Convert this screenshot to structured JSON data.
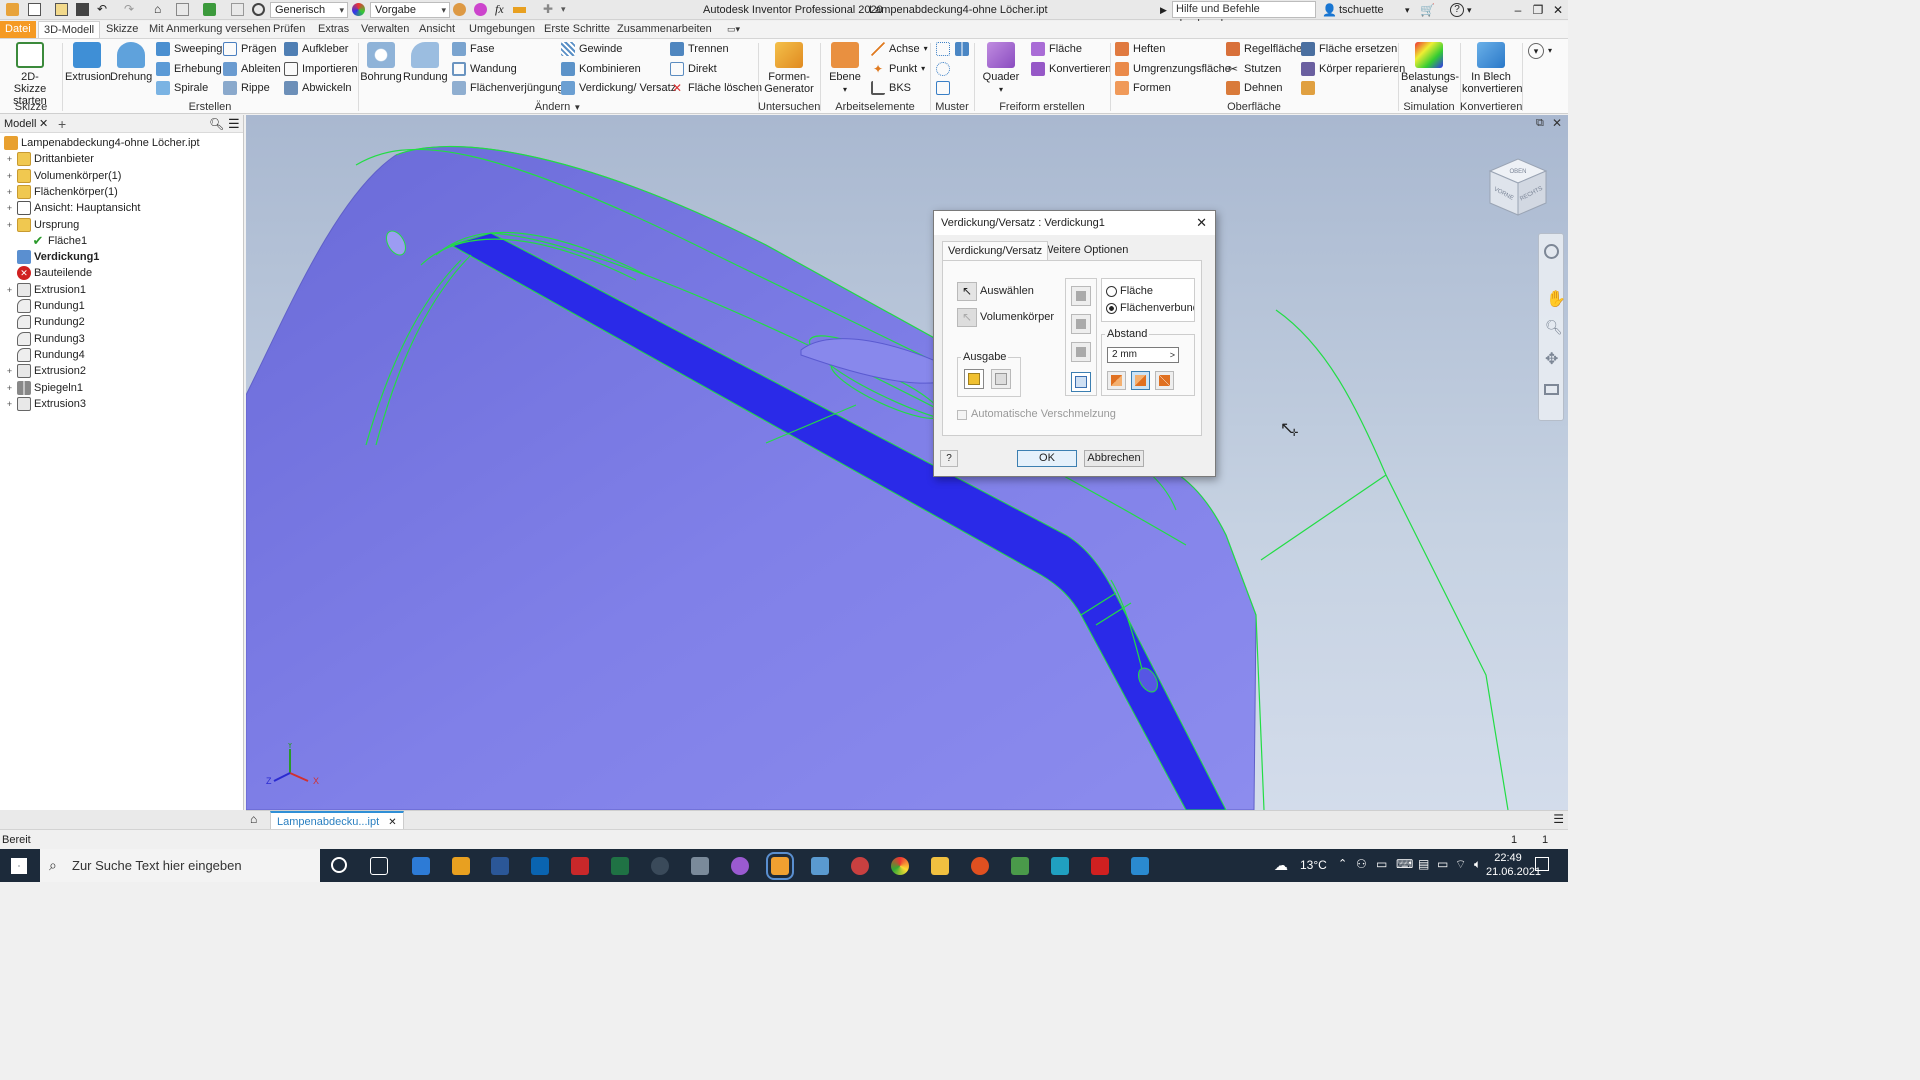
{
  "titlebar": {
    "appearance": "Generisch",
    "material": "Vorgabe",
    "title": "Autodesk Inventor Professional 2020",
    "document": "Lampenabdeckung4-ohne Löcher.ipt",
    "search": "Hilfe und Befehle durchsuchen...",
    "user": "tschuette",
    "help": "?"
  },
  "ribbon_tabs": [
    "Datei",
    "3D-Modell",
    "Skizze",
    "Mit Anmerkung versehen",
    "Prüfen",
    "Extras",
    "Verwalten",
    "Ansicht",
    "Umgebungen",
    "Erste Schritte",
    "Zusammenarbeiten"
  ],
  "ribbon": {
    "skizze_btn": "2D-Skizze starten",
    "extrusion": "Extrusion",
    "drehung": "Drehung",
    "erstellen_small": [
      "Sweeping",
      "Erhebung",
      "Spirale",
      "Prägen",
      "Ableiten",
      "Rippe",
      "Aufkleber",
      "Importieren",
      "Abwickeln"
    ],
    "bohrung": "Bohrung",
    "rundung": "Rundung",
    "aendern_small": [
      "Fase",
      "Wandung",
      "Flächenverjüngung",
      "Gewinde",
      "Kombinieren",
      "Verdickung/ Versatz",
      "Trennen",
      "Direkt",
      "Fläche löschen"
    ],
    "formen_gen": "Formen-Generator",
    "ebene": "Ebene",
    "arbeits_small": [
      "Achse",
      "Punkt",
      "BKS"
    ],
    "quader": "Quader",
    "freiform_small": [
      "Fläche",
      "Konvertieren"
    ],
    "oberflaeche_small": [
      "Heften",
      "Umgrenzungsfläche",
      "Formen",
      "Regelfläche",
      "Stutzen",
      "Dehnen",
      "Fläche ersetzen",
      "Körper reparieren"
    ],
    "belastung": "Belastungs-analyse",
    "blech": "In Blech konvertieren",
    "groups": [
      "Skizze",
      "Erstellen",
      "Ändern",
      "Untersuchen",
      "Arbeitselemente",
      "Muster",
      "Freiform erstellen",
      "Oberfläche",
      "Simulation",
      "Konvertieren"
    ]
  },
  "browser": {
    "tab": "Modell",
    "plus": "+",
    "items": [
      {
        "label": "Lampenabdeckung4-ohne Löcher.ipt",
        "level": 0,
        "icon": "part-icon",
        "exp": ""
      },
      {
        "label": "Drittanbieter",
        "level": 1,
        "icon": "folder-icon",
        "exp": "+"
      },
      {
        "label": "Volumenkörper(1)",
        "level": 1,
        "icon": "folder-icon",
        "exp": "+"
      },
      {
        "label": "Flächenkörper(1)",
        "level": 1,
        "icon": "folder-icon",
        "exp": "+"
      },
      {
        "label": "Ansicht: Hauptansicht",
        "level": 1,
        "icon": "view-icon",
        "exp": "+"
      },
      {
        "label": "Ursprung",
        "level": 1,
        "icon": "folder-icon",
        "exp": "+"
      },
      {
        "label": "Fläche1",
        "level": 2,
        "icon": "check-icon",
        "exp": ""
      },
      {
        "label": "Verdickung1",
        "level": 1,
        "icon": "thicken-icon",
        "exp": "",
        "bold": true
      },
      {
        "label": "Bauteilende",
        "level": 1,
        "icon": "end-icon",
        "exp": ""
      },
      {
        "label": "Extrusion1",
        "level": 1,
        "icon": "feature-icon",
        "exp": "+"
      },
      {
        "label": "Rundung1",
        "level": 1,
        "icon": "fillet-icon",
        "exp": ""
      },
      {
        "label": "Rundung2",
        "level": 1,
        "icon": "fillet-icon",
        "exp": ""
      },
      {
        "label": "Rundung3",
        "level": 1,
        "icon": "fillet-icon",
        "exp": ""
      },
      {
        "label": "Rundung4",
        "level": 1,
        "icon": "fillet-icon",
        "exp": ""
      },
      {
        "label": "Extrusion2",
        "level": 1,
        "icon": "feature-icon",
        "exp": "+"
      },
      {
        "label": "Spiegeln1",
        "level": 1,
        "icon": "mirror-icon",
        "exp": "+"
      },
      {
        "label": "Extrusion3",
        "level": 1,
        "icon": "feature-icon",
        "exp": "+"
      }
    ]
  },
  "dialog": {
    "title": "Verdickung/Versatz : Verdickung1",
    "tab1": "Verdickung/Versatz",
    "tab2": "Weitere Optionen",
    "auswaehlen": "Auswählen",
    "volumen": "Volumenkörper",
    "ausgabe": "Ausgabe",
    "radio1": "Fläche",
    "radio2": "Flächenverbund",
    "abstand": "Abstand",
    "abstand_value": "2 mm",
    "auto": "Automatische Verschmelzung",
    "ok": "OK",
    "cancel": "Abbrechen"
  },
  "viewcube": {
    "top": "OBEN",
    "front": "VORNE",
    "right": "RECHTS"
  },
  "triad": {
    "x": "X",
    "y": "Y",
    "z": "Z"
  },
  "doctab": "Lampenabdecku...ipt",
  "status": {
    "text": "Bereit",
    "n1": "1",
    "n2": "1"
  },
  "taskbar": {
    "search": "Zur Suche Text hier eingeben",
    "temp": "13°C",
    "time": "22:49",
    "date": "21.06.2021"
  },
  "colors": {
    "accent": "#f59a23",
    "surface": "#7f7fe6",
    "edge": "#22dd44",
    "thick": "#2a2ae8"
  }
}
